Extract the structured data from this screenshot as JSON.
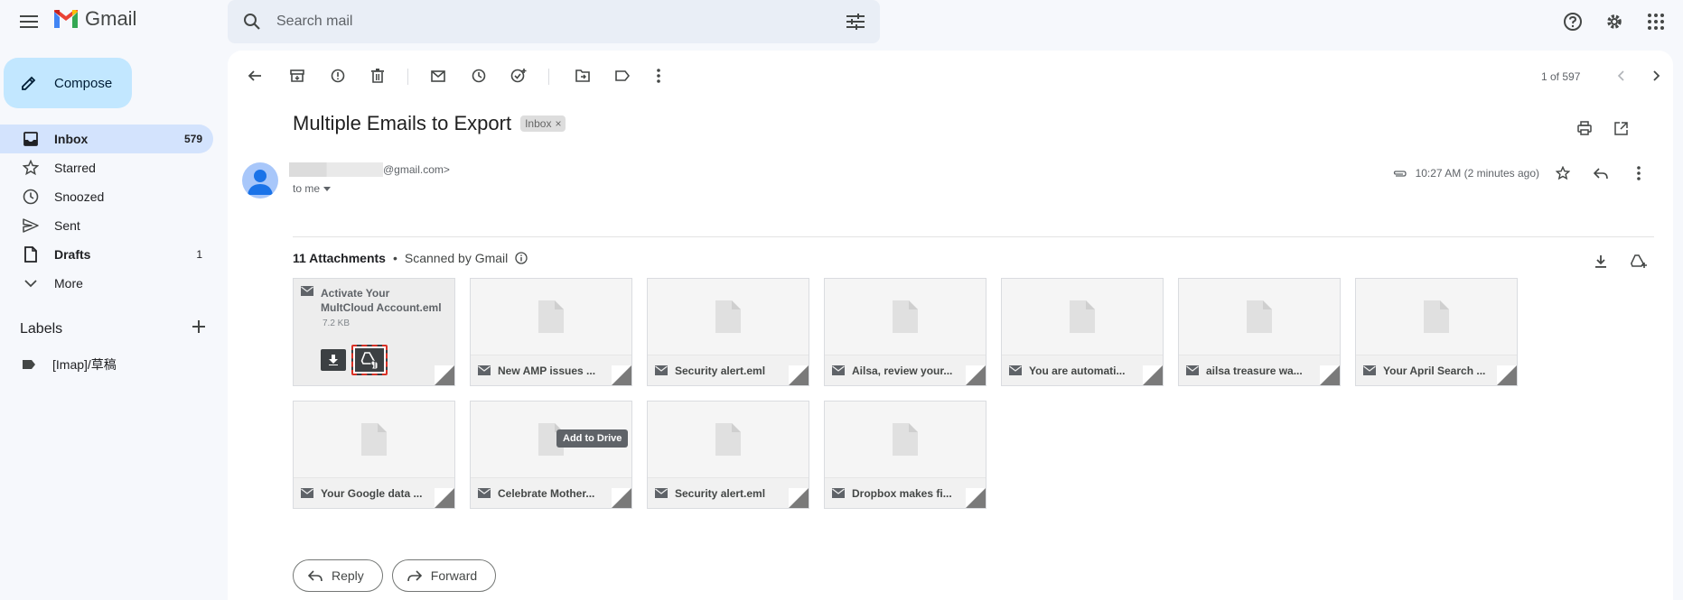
{
  "app": {
    "name": "Gmail"
  },
  "search": {
    "placeholder": "Search mail"
  },
  "compose": {
    "label": "Compose"
  },
  "nav": {
    "items": [
      {
        "label": "Inbox",
        "count": "579"
      },
      {
        "label": "Starred",
        "count": ""
      },
      {
        "label": "Snoozed",
        "count": ""
      },
      {
        "label": "Sent",
        "count": ""
      },
      {
        "label": "Drafts",
        "count": "1"
      },
      {
        "label": "More",
        "count": ""
      }
    ]
  },
  "labels": {
    "heading": "Labels",
    "items": [
      {
        "label": "[Imap]/草稿"
      }
    ]
  },
  "pager": {
    "text": "1 of 597"
  },
  "message": {
    "subject": "Multiple Emails to Export",
    "chip": "Inbox",
    "chip_close": "×",
    "sender_email_suffix": "@gmail.com>",
    "to": "to me",
    "time": "10:27 AM (2 minutes ago)"
  },
  "attachments": {
    "count_label": "11 Attachments",
    "bullet": "•",
    "scanned": "Scanned by Gmail",
    "hovered": {
      "title_line1": "Activate Your",
      "title_line2": "MultCloud Account.eml",
      "size": "7.2 KB",
      "tooltip": "Add to Drive"
    },
    "items": [
      {
        "name": "New AMP issues ..."
      },
      {
        "name": "Security alert.eml"
      },
      {
        "name": "Ailsa, review your..."
      },
      {
        "name": "You are automati..."
      },
      {
        "name": "ailsa treasure wa..."
      },
      {
        "name": "Your April Search ..."
      },
      {
        "name": "Your Google data ..."
      },
      {
        "name": "Celebrate Mother..."
      },
      {
        "name": "Security alert.eml"
      },
      {
        "name": "Dropbox makes fi..."
      }
    ]
  },
  "actions": {
    "reply": "Reply",
    "forward": "Forward"
  },
  "colors": {
    "accent": "#c2e7ff",
    "active_nav": "#d3e3fd",
    "highlight": "#d93025",
    "gmail_red": "#ea4335"
  }
}
